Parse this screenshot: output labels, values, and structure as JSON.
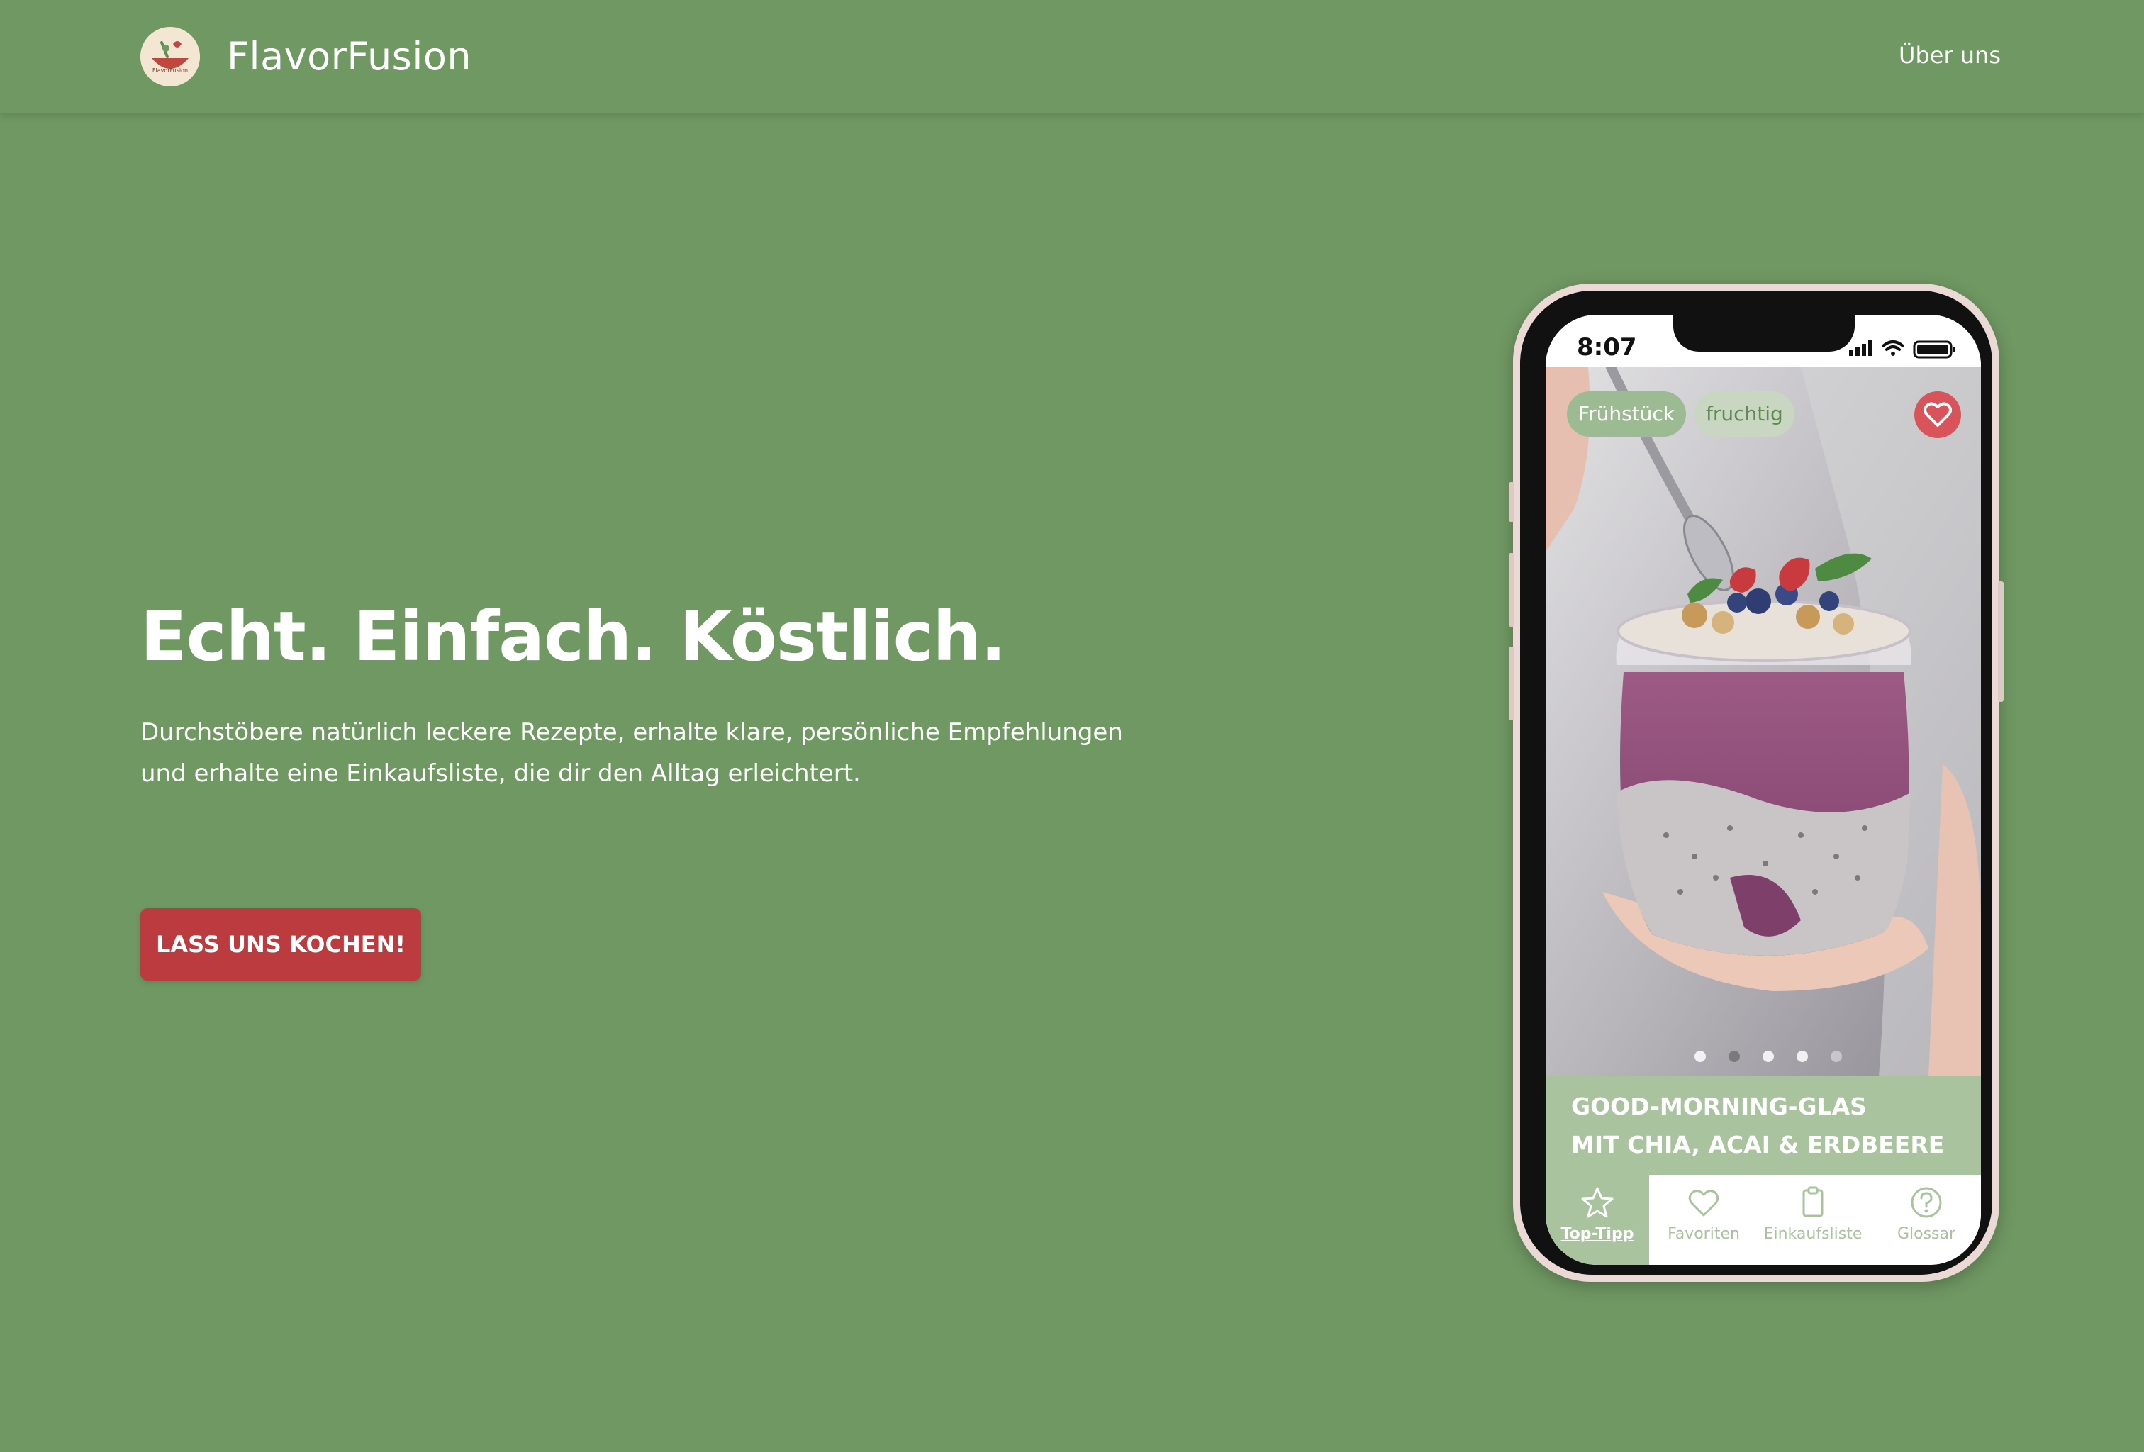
{
  "header": {
    "brand": "FlavorFusion",
    "logo_text": "FlavorFusion",
    "nav_about": "Über uns"
  },
  "hero": {
    "headline": "Echt. Einfach. Köstlich.",
    "subtext": "Durchstöbere natürlich leckere Rezepte, erhalte klare, persönliche Empfehlungen und erhalte eine Einkaufsliste, die dir den Alltag erleichtert.",
    "cta_label": "LASS UNS KOCHEN!"
  },
  "phone": {
    "time": "8:07",
    "tags": [
      "Frühstück",
      "fruchtig"
    ],
    "recipe_title_line1": "GOOD-MORNING-GLAS",
    "recipe_title_line2": "MIT CHIA, ACAI & ERDBEERE",
    "carousel_active_index": 1,
    "carousel_count": 5,
    "tabs": [
      {
        "label": "Top-Tipp",
        "icon": "star-icon",
        "active": true
      },
      {
        "label": "Favoriten",
        "icon": "heart-icon",
        "active": false
      },
      {
        "label": "Einkaufsliste",
        "icon": "clipboard-icon",
        "active": false
      },
      {
        "label": "Glossar",
        "icon": "question-icon",
        "active": false
      }
    ]
  },
  "colors": {
    "background": "#709863",
    "cta": "#bb3b3e",
    "accent_light_green": "#a8c39d",
    "favorite_red": "#d9545a"
  }
}
